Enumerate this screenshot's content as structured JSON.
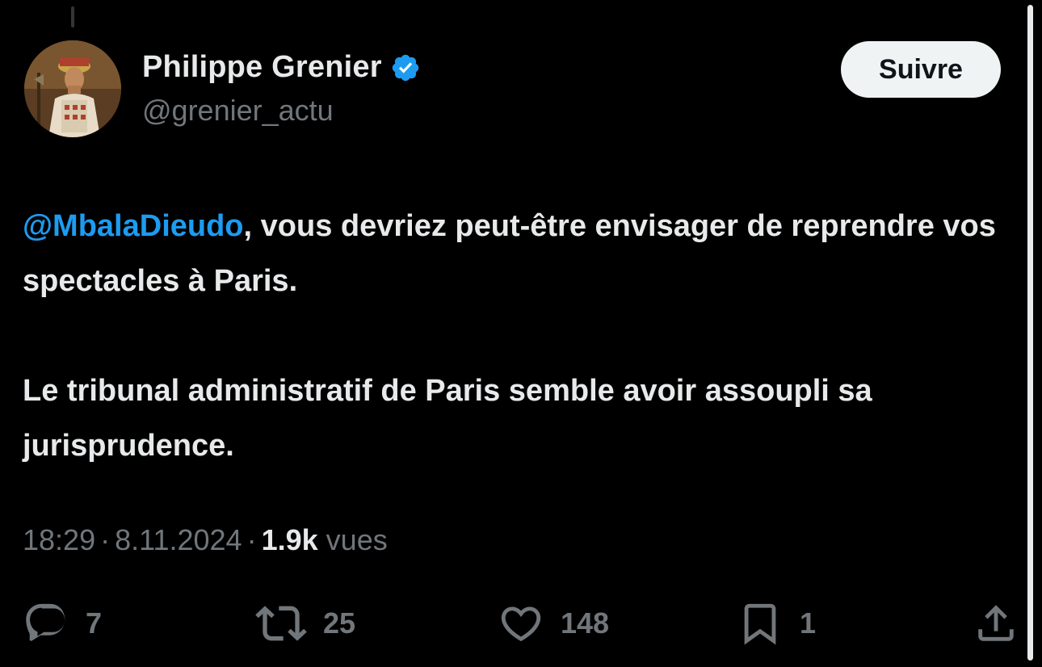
{
  "author": {
    "name": "Philippe Grenier",
    "handle": "@grenier_actu",
    "verified": true,
    "avatar": "portrait-avatar"
  },
  "follow_button": {
    "label": "Suivre"
  },
  "tweet": {
    "mention": "@MbalaDieudo",
    "line1_rest": ", vous devriez peut-être envisager de reprendre vos spectacles à Paris.",
    "paragraph2": "Le tribunal administratif de Paris semble avoir assoupli sa jurisprudence."
  },
  "meta": {
    "time": "18:29",
    "date": "8.11.2024",
    "views_count": "1.9k",
    "views_label": "vues",
    "separator": "·"
  },
  "actions": {
    "replies": "7",
    "retweets": "25",
    "likes": "148",
    "bookmarks": "1"
  },
  "icons": {
    "reply": "reply-icon",
    "retweet": "retweet-icon",
    "like": "heart-icon",
    "bookmark": "bookmark-icon",
    "share": "share-icon",
    "verified": "verified-badge-icon"
  },
  "colors": {
    "background": "#000000",
    "text": "#e7e9ea",
    "secondary": "#71767b",
    "accent": "#1d9bf0",
    "button_bg": "#eff3f4"
  }
}
